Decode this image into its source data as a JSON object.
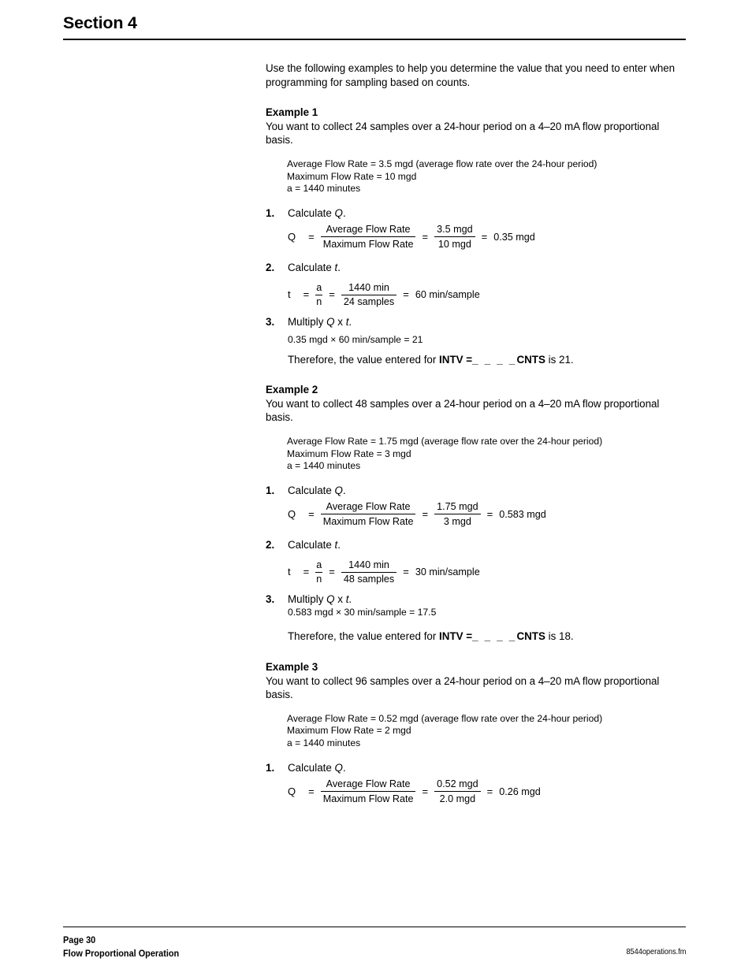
{
  "header": {
    "section_title": "Section 4"
  },
  "intro": {
    "text": "Use the following examples to help you determine the value that you need to enter when programming for sampling based on counts."
  },
  "examples": [
    {
      "heading": "Example 1",
      "description": "You want to collect 24 samples over a 24-hour period on a 4–20 mA flow proportional basis.",
      "givens": [
        "Average Flow Rate = 3.5 mgd (average flow rate over the 24-hour period)",
        "Maximum Flow Rate = 10 mgd",
        "a = 1440 minutes"
      ],
      "step1": {
        "number": "1.",
        "label_pre": "Calculate ",
        "label_var": "Q",
        "label_post": ".",
        "eq": {
          "lhs": "Q",
          "op1": "=",
          "frac1_num": "Average Flow Rate",
          "frac1_den": "Maximum Flow Rate",
          "op2": "=",
          "frac2_num": "3.5 mgd",
          "frac2_den": "10 mgd",
          "op3": "=",
          "result": "0.35 mgd"
        }
      },
      "step2": {
        "number": "2.",
        "label_pre": "Calculate ",
        "label_var": "t",
        "label_post": ".",
        "eq": {
          "lhs": "t",
          "op1": "=",
          "frac1_num": "a",
          "frac1_den": "n",
          "op2": "=",
          "frac2_num": "1440 min",
          "frac2_den": "24 samples",
          "op3": "=",
          "result": "60 min/sample"
        }
      },
      "step3": {
        "number": "3.",
        "label_pre": "Multiply ",
        "label_var": "Q",
        "label_mid": " x ",
        "label_var2": "t",
        "label_post": ".",
        "product_line": "0.35 mgd × 60 min/sample  =  21",
        "conclusion_pre": "Therefore, the value entered for ",
        "conclusion_bold1": "INTV =",
        "conclusion_dashes": "_ _ _ _",
        "conclusion_bold2": "CNTS",
        "conclusion_post": " is 21."
      }
    },
    {
      "heading": "Example 2",
      "description": "You want to collect 48 samples over a 24-hour period on a 4–20 mA flow proportional basis.",
      "givens": [
        "Average Flow Rate = 1.75 mgd (average flow rate over the 24-hour period)",
        "Maximum Flow Rate = 3 mgd",
        "a = 1440 minutes"
      ],
      "step1": {
        "number": "1.",
        "label_pre": "Calculate ",
        "label_var": "Q",
        "label_post": ".",
        "eq": {
          "lhs": "Q",
          "op1": "=",
          "frac1_num": "Average Flow Rate",
          "frac1_den": "Maximum Flow Rate",
          "op2": "=",
          "frac2_num": "1.75 mgd",
          "frac2_den": "3 mgd",
          "op3": "=",
          "result": "0.583 mgd"
        }
      },
      "step2": {
        "number": "2.",
        "label_pre": "Calculate ",
        "label_var": "t",
        "label_post": ".",
        "eq": {
          "lhs": "t",
          "op1": "=",
          "frac1_num": "a",
          "frac1_den": "n",
          "op2": "=",
          "frac2_num": "1440 min",
          "frac2_den": "48 samples",
          "op3": "=",
          "result": "30 min/sample"
        }
      },
      "step3": {
        "number": "3.",
        "label_pre": "Multiply ",
        "label_var": "Q",
        "label_mid": " x ",
        "label_var2": "t",
        "label_post": ".",
        "product_line": "0.583 mgd × 30 min/sample  =  17.5",
        "conclusion_pre": "Therefore, the value entered for ",
        "conclusion_bold1": "INTV =",
        "conclusion_dashes": "_ _ _ _",
        "conclusion_bold2": "CNTS",
        "conclusion_post": " is 18."
      }
    },
    {
      "heading": "Example 3",
      "description": "You want to collect 96 samples over a 24-hour period on a 4–20 mA flow proportional basis.",
      "givens": [
        "Average Flow Rate = 0.52 mgd (average flow rate over the 24-hour period)",
        "Maximum Flow Rate = 2 mgd",
        "a = 1440 minutes"
      ],
      "step1": {
        "number": "1.",
        "label_pre": "Calculate ",
        "label_var": "Q",
        "label_post": ".",
        "eq": {
          "lhs": "Q",
          "op1": "=",
          "frac1_num": "Average Flow Rate",
          "frac1_den": "Maximum Flow Rate",
          "op2": "=",
          "frac2_num": "0.52 mgd",
          "frac2_den": "2.0 mgd",
          "op3": "=",
          "result": "0.26 mgd"
        }
      }
    }
  ],
  "footer": {
    "page": "Page 30",
    "chapter": "Flow Proportional Operation",
    "filename": "8544operations.fm"
  }
}
